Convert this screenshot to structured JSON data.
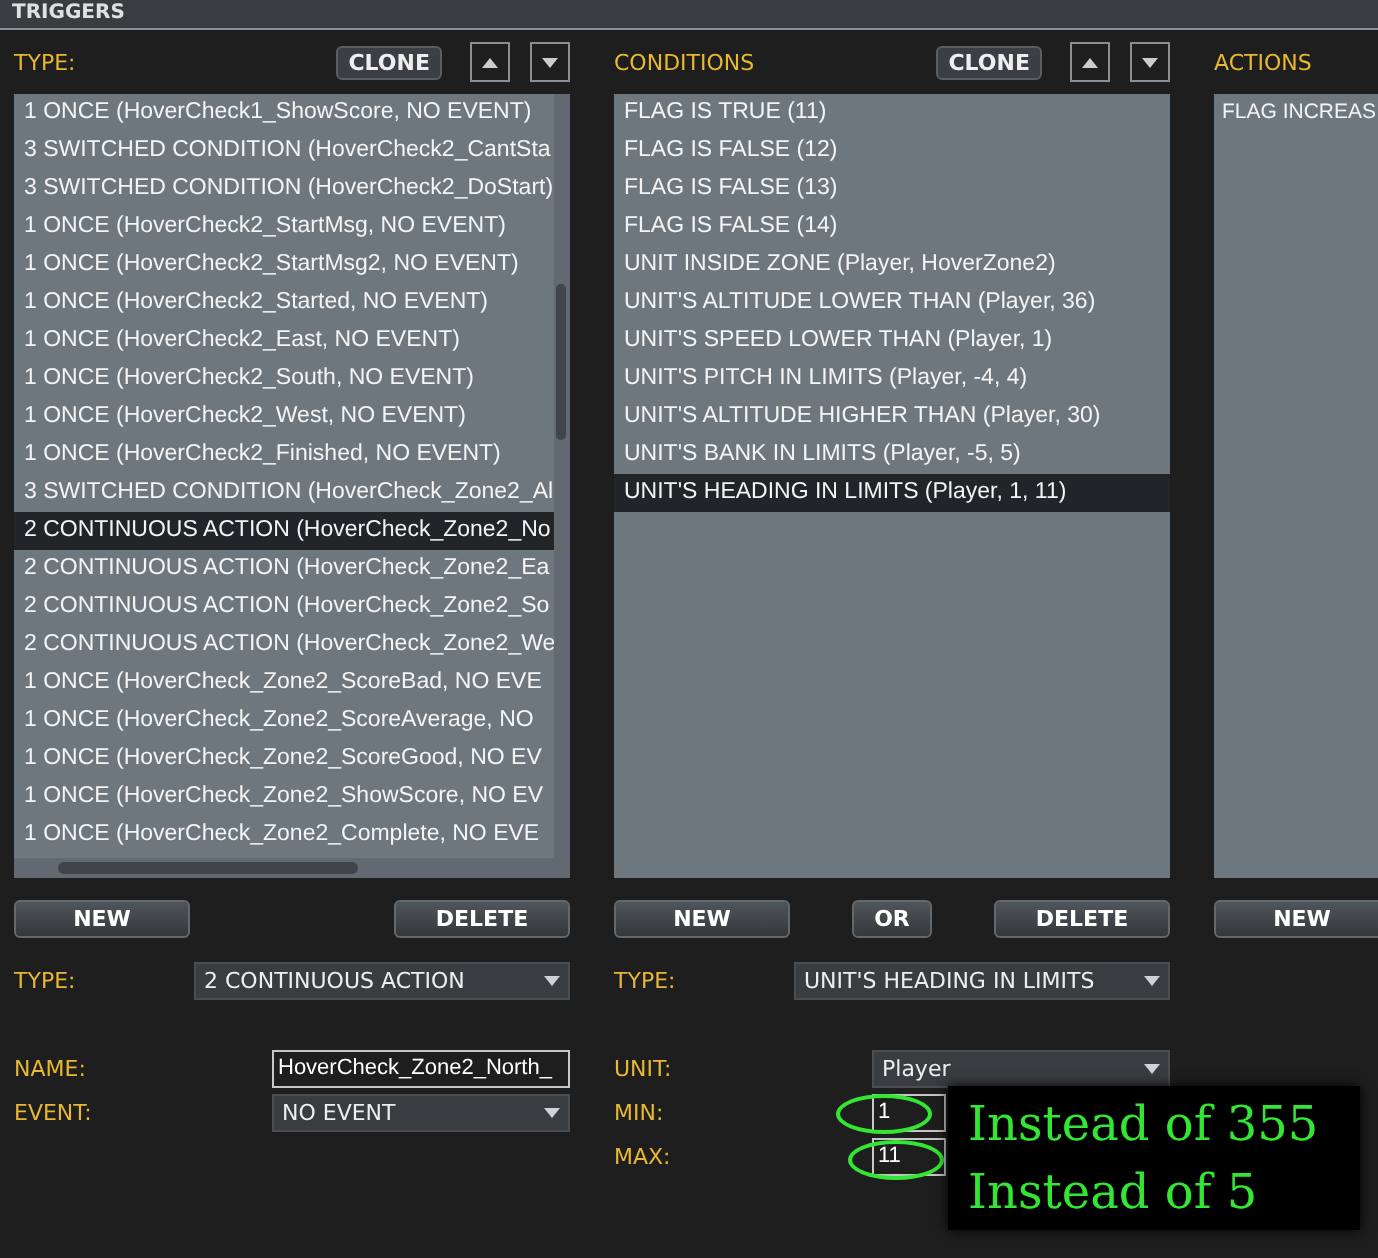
{
  "window": {
    "title": "TRIGGERS"
  },
  "triggers": {
    "label": "TYPE:",
    "clone": "CLONE",
    "items": [
      {
        "text": "1 ONCE (HoverCheck1_ShowScore, NO EVENT)",
        "selected": false
      },
      {
        "text": "3 SWITCHED CONDITION (HoverCheck2_CantSta",
        "selected": false
      },
      {
        "text": "3 SWITCHED CONDITION (HoverCheck2_DoStart)",
        "selected": false
      },
      {
        "text": "1 ONCE (HoverCheck2_StartMsg, NO EVENT)",
        "selected": false
      },
      {
        "text": "1 ONCE (HoverCheck2_StartMsg2, NO EVENT)",
        "selected": false
      },
      {
        "text": "1 ONCE (HoverCheck2_Started, NO EVENT)",
        "selected": false
      },
      {
        "text": "1 ONCE (HoverCheck2_East, NO EVENT)",
        "selected": false
      },
      {
        "text": "1 ONCE (HoverCheck2_South, NO EVENT)",
        "selected": false
      },
      {
        "text": "1 ONCE (HoverCheck2_West, NO EVENT)",
        "selected": false
      },
      {
        "text": "1 ONCE (HoverCheck2_Finished, NO EVENT)",
        "selected": false
      },
      {
        "text": "3 SWITCHED CONDITION (HoverCheck_Zone2_Al",
        "selected": false
      },
      {
        "text": "2 CONTINUOUS ACTION (HoverCheck_Zone2_No",
        "selected": true
      },
      {
        "text": "2 CONTINUOUS ACTION (HoverCheck_Zone2_Ea",
        "selected": false
      },
      {
        "text": "2 CONTINUOUS ACTION (HoverCheck_Zone2_So",
        "selected": false
      },
      {
        "text": "2 CONTINUOUS ACTION (HoverCheck_Zone2_We",
        "selected": false
      },
      {
        "text": "1 ONCE (HoverCheck_Zone2_ScoreBad, NO EVE",
        "selected": false
      },
      {
        "text": "1 ONCE (HoverCheck_Zone2_ScoreAverage, NO",
        "selected": false
      },
      {
        "text": "1 ONCE (HoverCheck_Zone2_ScoreGood, NO EV",
        "selected": false
      },
      {
        "text": "1 ONCE (HoverCheck_Zone2_ShowScore, NO EV",
        "selected": false
      },
      {
        "text": "1 ONCE (HoverCheck_Zone2_Complete, NO EVE",
        "selected": false
      }
    ],
    "buttons": [
      "NEW",
      "DELETE"
    ],
    "fields": [
      {
        "kind": "dropdown",
        "label": "TYPE:",
        "value": "2 CONTINUOUS ACTION"
      },
      {
        "kind": "gap"
      },
      {
        "kind": "input",
        "label": "NAME:",
        "value": "HoverCheck_Zone2_North_"
      },
      {
        "kind": "dropdown",
        "label": "EVENT:",
        "value": "NO EVENT"
      }
    ]
  },
  "conditions": {
    "label": "CONDITIONS",
    "clone": "CLONE",
    "items": [
      {
        "text": "FLAG IS TRUE (11)",
        "selected": false
      },
      {
        "text": "FLAG IS FALSE (12)",
        "selected": false
      },
      {
        "text": "FLAG IS FALSE (13)",
        "selected": false
      },
      {
        "text": "FLAG IS FALSE (14)",
        "selected": false
      },
      {
        "text": "UNIT INSIDE ZONE (Player, HoverZone2)",
        "selected": false
      },
      {
        "text": "UNIT'S ALTITUDE LOWER THAN (Player, 36)",
        "selected": false
      },
      {
        "text": "UNIT'S SPEED LOWER THAN (Player, 1)",
        "selected": false
      },
      {
        "text": "UNIT'S PITCH IN LIMITS (Player, -4, 4)",
        "selected": false
      },
      {
        "text": "UNIT'S ALTITUDE HIGHER THAN (Player, 30)",
        "selected": false
      },
      {
        "text": "UNIT'S BANK IN LIMITS (Player, -5, 5)",
        "selected": false
      },
      {
        "text": "UNIT'S HEADING IN LIMITS (Player, 1, 11)",
        "selected": true
      }
    ],
    "buttons": [
      "NEW",
      "OR",
      "DELETE"
    ],
    "fields": [
      {
        "kind": "dropdown",
        "label": "TYPE:",
        "value": "UNIT'S HEADING IN LIMITS"
      },
      {
        "kind": "gap"
      },
      {
        "kind": "dropdown",
        "label": "UNIT:",
        "value": "Player"
      },
      {
        "kind": "input",
        "label": "MIN:",
        "value": "1"
      },
      {
        "kind": "input",
        "label": "MAX:",
        "value": "11"
      }
    ]
  },
  "actions": {
    "label": "ACTIONS",
    "items": [
      {
        "text": "FLAG INCREAS",
        "selected": false
      }
    ],
    "buttons": [
      "NEW"
    ]
  },
  "annotations": [
    "Instead of 355",
    "Instead of 5"
  ]
}
